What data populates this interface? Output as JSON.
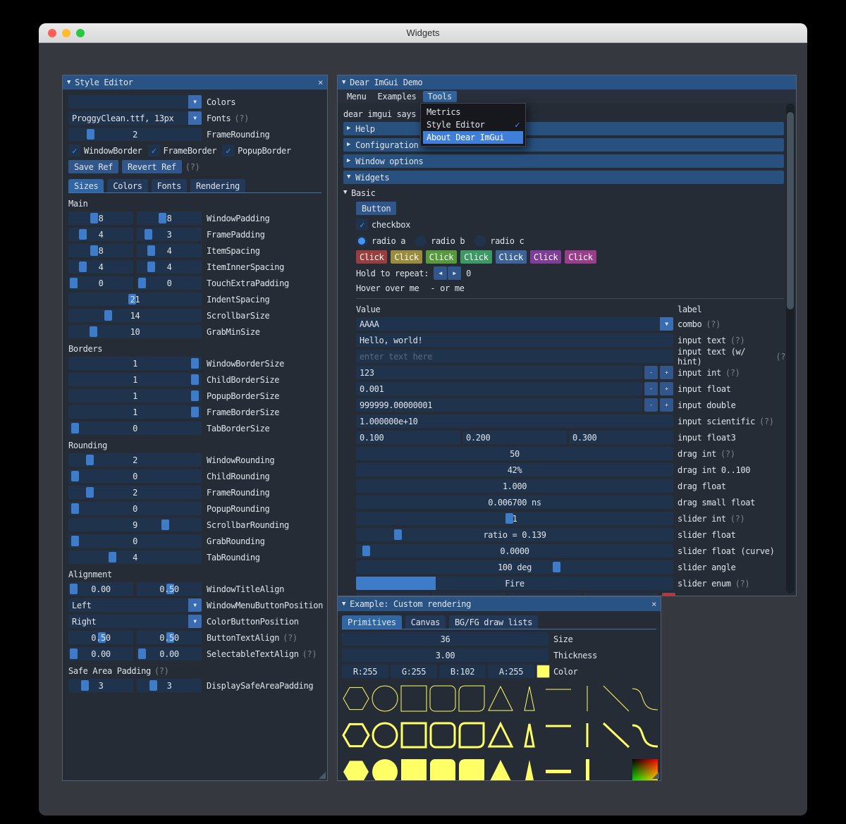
{
  "ui": {
    "help": "(?)",
    "minus": "-",
    "plus": "+",
    "close": "×",
    "arrow_down": "▼",
    "arrow_right": "▶",
    "arrow_left_btn": "◀",
    "arrow_right_btn": "▶",
    "check": "✓"
  },
  "macos": {
    "title": "Widgets"
  },
  "style_editor": {
    "title": "Style Editor",
    "colors_combo": {
      "value": "",
      "label": "Colors"
    },
    "fonts_combo": {
      "value": "ProggyClean.ttf, 13px",
      "label": "Fonts"
    },
    "frame_rounding_top": {
      "value": "2",
      "label": "FrameRounding",
      "grab": 14
    },
    "checks": [
      "WindowBorder",
      "FrameBorder",
      "PopupBorder"
    ],
    "save_btn": "Save Ref",
    "revert_btn": "Revert Ref",
    "tabs": [
      "Sizes",
      "Colors",
      "Fonts",
      "Rendering"
    ],
    "sections": {
      "main": "Main",
      "borders": "Borders",
      "rounding": "Rounding",
      "alignment": "Alignment",
      "safe": "Safe Area Padding"
    },
    "main_pairs": [
      {
        "a": "8",
        "b": "8",
        "label": "WindowPadding",
        "ga": 34,
        "gb": 34
      },
      {
        "a": "4",
        "b": "3",
        "label": "FramePadding",
        "ga": 16,
        "gb": 12
      },
      {
        "a": "8",
        "b": "4",
        "label": "ItemSpacing",
        "ga": 34,
        "gb": 16
      },
      {
        "a": "4",
        "b": "4",
        "label": "ItemInnerSpacing",
        "ga": 16,
        "gb": 16
      },
      {
        "a": "0",
        "b": "0",
        "label": "TouchExtraPadding",
        "ga": 2,
        "gb": 2
      }
    ],
    "main_singles": [
      {
        "v": "21",
        "label": "IndentSpacing",
        "g": 45
      },
      {
        "v": "14",
        "label": "ScrollbarSize",
        "g": 27
      },
      {
        "v": "10",
        "label": "GrabMinSize",
        "g": 16
      }
    ],
    "border_singles": [
      {
        "v": "1",
        "label": "WindowBorderSize",
        "g": 92
      },
      {
        "v": "1",
        "label": "ChildBorderSize",
        "g": 92
      },
      {
        "v": "1",
        "label": "PopupBorderSize",
        "g": 92
      },
      {
        "v": "1",
        "label": "FrameBorderSize",
        "g": 92
      },
      {
        "v": "0",
        "label": "TabBorderSize",
        "g": 2
      }
    ],
    "rounding_singles": [
      {
        "v": "2",
        "label": "WindowRounding",
        "g": 13
      },
      {
        "v": "0",
        "label": "ChildRounding",
        "g": 2
      },
      {
        "v": "2",
        "label": "FrameRounding",
        "g": 13
      },
      {
        "v": "0",
        "label": "PopupRounding",
        "g": 2
      },
      {
        "v": "9",
        "label": "ScrollbarRounding",
        "g": 70
      },
      {
        "v": "0",
        "label": "GrabRounding",
        "g": 2
      },
      {
        "v": "4",
        "label": "TabRounding",
        "g": 30
      }
    ],
    "title_align": {
      "a": "0.00",
      "b": "0.50",
      "label": "WindowTitleAlign",
      "ga": 2,
      "gb": 46
    },
    "menu_btn_combo": {
      "value": "Left",
      "label": "WindowMenuButtonPosition"
    },
    "color_btn_combo": {
      "value": "Right",
      "label": "ColorButtonPosition"
    },
    "button_align": {
      "a": "0.50",
      "b": "0.50",
      "label": "ButtonTextAlign",
      "ga": 46,
      "gb": 46
    },
    "selectable_align": {
      "a": "0.00",
      "b": "0.00",
      "label": "SelectableTextAlign",
      "ga": 2,
      "gb": 2
    },
    "safe_pair": {
      "a": "3",
      "b": "3",
      "label": "DisplaySafeAreaPadding",
      "ga": 20,
      "gb": 20
    }
  },
  "demo": {
    "title": "Dear ImGui Demo",
    "menubar": [
      "Menu",
      "Examples",
      "Tools"
    ],
    "says": "dear imgui says",
    "menu_popup": [
      "Metrics",
      "Style Editor",
      "About Dear ImGui"
    ],
    "headers": [
      "Help",
      "Configuration",
      "Window options",
      "Widgets"
    ],
    "basic_label": "Basic",
    "button_label": "Button",
    "checkbox_label": "checkbox",
    "radios": [
      "radio a",
      "radio b",
      "radio c"
    ],
    "click_label": "Click",
    "click_colors": [
      "#993d3d",
      "#998c3d",
      "#57993d",
      "#3d9964",
      "#3d6499",
      "#7f3d99",
      "#993d8c"
    ],
    "hold_label": "Hold to repeat:",
    "hold_count": "0",
    "hover_a": "Hover over me",
    "hover_b": "- or me",
    "col_value": "Value",
    "col_label": "label",
    "combo_row": {
      "value": "AAAA",
      "label": "combo"
    },
    "text_row": {
      "value": "Hello, world!",
      "label": "input text"
    },
    "hint_row": {
      "placeholder": "enter text here",
      "label": "input text (w/ hint)"
    },
    "int_row": {
      "value": "123",
      "label": "input int"
    },
    "float_row": {
      "value": "0.001",
      "label": "input float"
    },
    "double_row": {
      "value": "999999.00000001",
      "label": "input double"
    },
    "sci_row": {
      "value": "1.000000e+10",
      "label": "input scientific"
    },
    "float3_row": {
      "a": "0.100",
      "b": "0.200",
      "c": "0.300",
      "label": "input float3"
    },
    "drag_int_row": {
      "value": "50",
      "label": "drag int"
    },
    "drag_pct_row": {
      "value": "42%",
      "label": "drag int 0..100"
    },
    "drag_float_row": {
      "value": "1.000",
      "label": "drag float"
    },
    "drag_small_row": {
      "value": "0.006700 ns",
      "label": "drag small float"
    },
    "slider_int_row": {
      "value": "1",
      "label": "slider int",
      "grab": 47
    },
    "slider_float_row": {
      "value": "ratio = 0.139",
      "label": "slider float",
      "grab": 12
    },
    "slider_curve_row": {
      "value": "0.0000",
      "label": "slider float (curve)",
      "grab": 2
    },
    "slider_angle_row": {
      "value": "100 deg",
      "label": "slider angle",
      "grab": 62
    },
    "slider_enum_row": {
      "value": "Fire",
      "label": "slider enum",
      "fill": 25
    },
    "partial_row": {
      "a": "",
      "b": "",
      "c": "",
      "d": "",
      "swatch": "#e0262c"
    }
  },
  "custom": {
    "title": "Example: Custom rendering",
    "tabs": [
      "Primitives",
      "Canvas",
      "BG/FG draw lists"
    ],
    "size_row": {
      "value": "36",
      "label": "Size"
    },
    "thickness_row": {
      "value": "3.00",
      "label": "Thickness"
    },
    "color_row": {
      "r": "R:255",
      "g": "G:255",
      "b": "B:102",
      "a": "A:255",
      "label": "Color",
      "swatch": "#ffff66"
    },
    "shape_color": "#ffff66",
    "shapes": [
      "hexagon",
      "circle",
      "square",
      "rounded-square",
      "rounded-square-corners",
      "triangle",
      "thin-triangle",
      "horizontal-line",
      "vertical-line",
      "diagonal-line",
      "bezier-curve",
      "gradient-rect"
    ]
  }
}
